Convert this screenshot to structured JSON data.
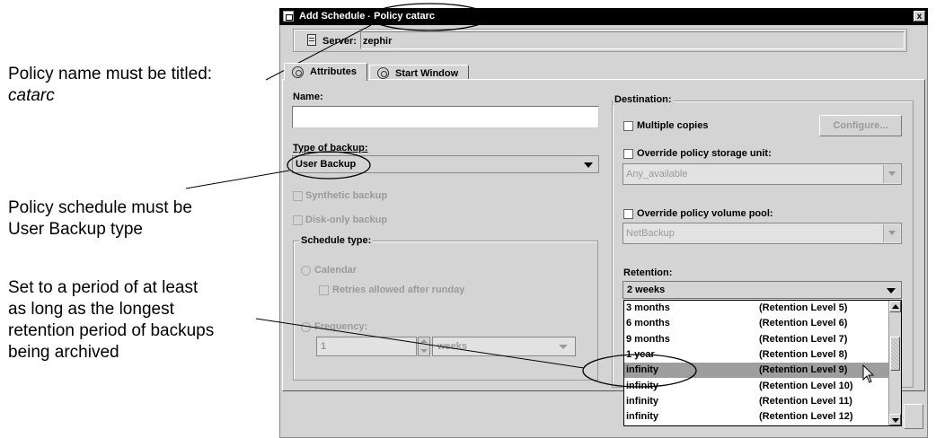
{
  "annotations": {
    "policy_name_line1": "Policy name must be titled:",
    "policy_name_line2": "catarc",
    "schedule_line1": "Policy schedule must be",
    "schedule_line2": "User Backup type",
    "retention_line1": "Set to a period of at least",
    "retention_line2": "as long as the longest",
    "retention_line3": "retention period of backups",
    "retention_line4": "being archived"
  },
  "window": {
    "title": "Add Schedule - Policy catarc",
    "close_label": "x"
  },
  "server": {
    "label": "Server:",
    "value": "zephir"
  },
  "tabs": [
    {
      "label": "Attributes"
    },
    {
      "label": "Start Window"
    }
  ],
  "attributes": {
    "name_label": "Name:",
    "name_value": "",
    "type_of_backup_label": "Type of backup:",
    "type_of_backup_value": "User Backup",
    "synthetic_backup_label": "Synthetic backup",
    "disk_only_backup_label": "Disk-only backup",
    "schedule_type_label": "Schedule type:",
    "calendar_label": "Calendar",
    "retries_label": "Retries allowed after runday",
    "frequency_label": "Frequency:",
    "frequency_value": "1",
    "frequency_unit": "weeks"
  },
  "destination": {
    "label": "Destination:",
    "multiple_copies_label": "Multiple copies",
    "configure_label": "Configure...",
    "override_storage_label": "Override policy storage unit:",
    "storage_value": "Any_available",
    "override_volume_label": "Override policy volume pool:",
    "volume_value": "NetBackup",
    "retention_label": "Retention:",
    "retention_value": "2 weeks"
  },
  "retention_options": [
    {
      "period": "3 months",
      "level": "(Retention Level 5)"
    },
    {
      "period": "6 months",
      "level": "(Retention Level 6)"
    },
    {
      "period": "9 months",
      "level": "(Retention Level 7)"
    },
    {
      "period": "1 year",
      "level": "(Retention Level 8)"
    },
    {
      "period": "infinity",
      "level": "(Retention Level 9)"
    },
    {
      "period": "infinity",
      "level": "(Retention Level 10)"
    },
    {
      "period": "infinity",
      "level": "(Retention Level 11)"
    },
    {
      "period": "infinity",
      "level": "(Retention Level 12)"
    }
  ],
  "retention_selected_index": 4,
  "colors": {
    "dialog_bg": "#d4d4d4",
    "titlebar_bg": "#000000",
    "selection_bg": "#9e9e9e",
    "disabled_text": "#9a9a9a"
  }
}
